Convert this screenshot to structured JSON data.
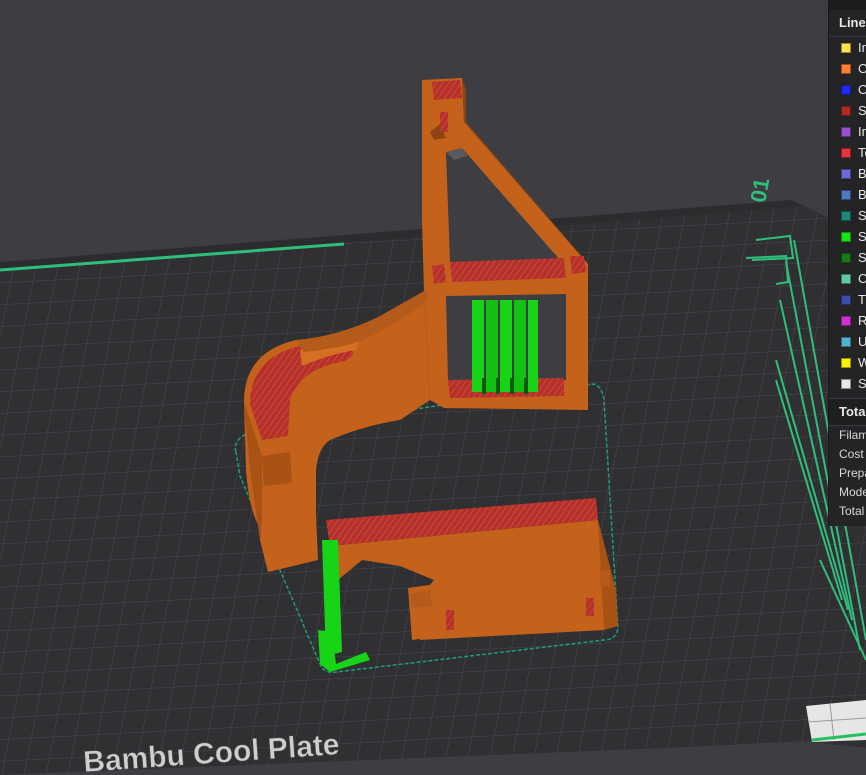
{
  "plate": {
    "label": "Bambu Cool Plate",
    "number": "01"
  },
  "legend": {
    "header": "Line Type",
    "items": [
      {
        "label": "Inner wall",
        "color": "#ffe24a"
      },
      {
        "label": "Outer wall",
        "color": "#ff7f32"
      },
      {
        "label": "Overhang wall",
        "color": "#1f2bf0"
      },
      {
        "label": "Sparse infill",
        "color": "#b02a22"
      },
      {
        "label": "Internal solid infill",
        "color": "#9b4fd0"
      },
      {
        "label": "Top surface",
        "color": "#e8343c"
      },
      {
        "label": "Bottom surface",
        "color": "#6a6ad8"
      },
      {
        "label": "Bridge",
        "color": "#4f79c0"
      },
      {
        "label": "Skirt",
        "color": "#1a8a78"
      },
      {
        "label": "Support",
        "color": "#14e614"
      },
      {
        "label": "Support interface",
        "color": "#197a19"
      },
      {
        "label": "Custom",
        "color": "#5ec9a3"
      },
      {
        "label": "Travel",
        "color": "#3a4fa8"
      },
      {
        "label": "Retract",
        "color": "#d22fd6"
      },
      {
        "label": "Unretract",
        "color": "#4fb2d0"
      },
      {
        "label": "Wipe",
        "color": "#fff000"
      },
      {
        "label": "Seams",
        "color": "#e8e8e8"
      }
    ],
    "totals_header": "Total",
    "totals": [
      {
        "label": "Filament"
      },
      {
        "label": "Cost"
      },
      {
        "label": "Prepare time"
      },
      {
        "label": "Model printing time"
      },
      {
        "label": "Total time"
      }
    ]
  },
  "colors": {
    "background": "#3e3e42",
    "bed": "#303033",
    "grid": "#4c4c50",
    "part": "#c4621c",
    "infill": "#b3302b",
    "support": "#17d417",
    "skirt": "#24a37a"
  }
}
